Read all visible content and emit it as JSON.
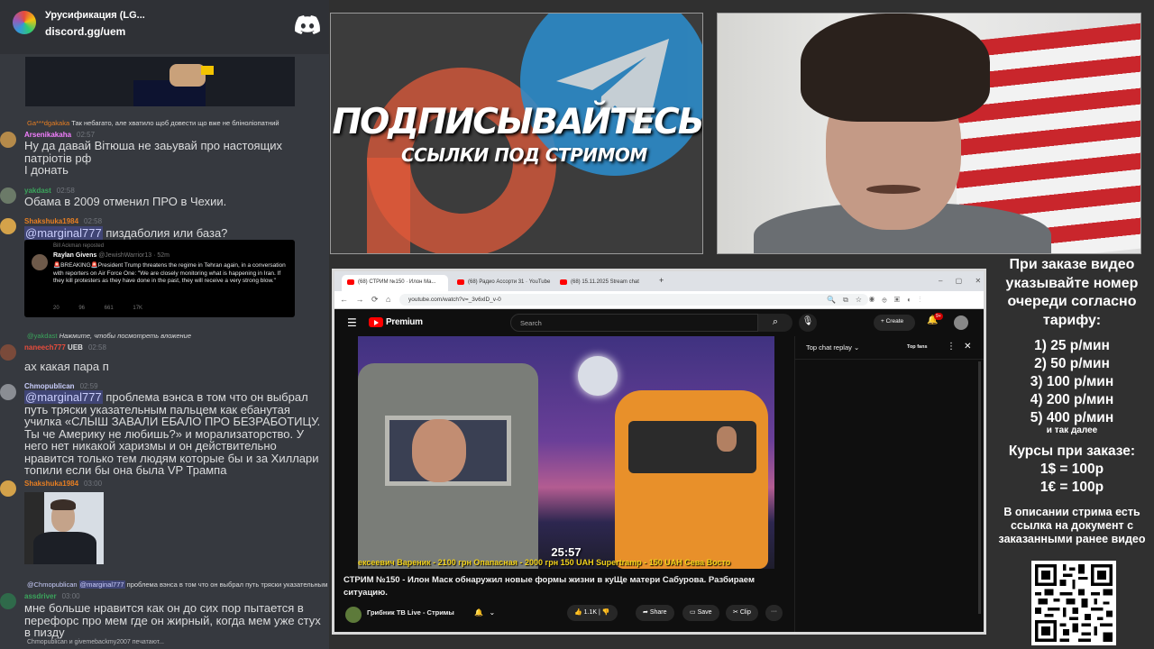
{
  "discord": {
    "server_name": "Урусификация (LG...",
    "server_link": "discord.gg/uem",
    "messages": [
      {
        "reply_name": "Ga***dgakaka",
        "reply_text": "Так небагато, але хватило щоб довести що вже не бліноліопатний",
        "user": "Arsenikakaha",
        "time": "02:57",
        "text": "Ну да давай Вітюша не заьувай про настоящих патріотів рф\nІ донать"
      },
      {
        "user": "yakdast",
        "time": "02:58",
        "text": "Обама в 2009 отменил ПРО в Чехии."
      },
      {
        "user": "Shakshuka1984",
        "time": "02:58",
        "mention": "@marginal777",
        "text": " пиздаболия или база?"
      },
      {
        "reply_name": "@yakdast",
        "reply_text": "Нажмите, чтобы посмотреть вложение",
        "user": "naneech777",
        "user_tag": "UEB",
        "time": "02:58",
        "text": "ах какая пара п"
      },
      {
        "user": "Chmopublican",
        "time": "02:59",
        "mention": "@marginal777",
        "text": " проблема вэнса в том что он выбрал путь тряски указательным пальцем как ебанутая училка «СЛЫШ ЗАВАЛИ ЕБАЛО ПРО БЕЗРАБОТИЦУ. Ты че Америку не любишь?» и морализаторство. У него нет никакой харизмы и он действительно нравится только тем людям которые бы и за Хиллари топили если бы она была VP Трампа"
      },
      {
        "user": "Shakshuka1984",
        "time": "03:00"
      },
      {
        "reply_name": "@Chmopublican",
        "reply_mention": "@marginal777",
        "reply_text": " проблема вэнса в том что он выбрал путь тряски указательным п...",
        "user": "assdriver",
        "time": "03:00",
        "text": "мне больше нравится как он до сих пор пытается в перефорс про мем где он жирный, когда мем уже стух в пизду"
      }
    ],
    "tweet": {
      "reposted": "Bill Ackman reposted",
      "name": "Raylan Givens",
      "handle": "@JewishWarrior13 · 52m",
      "body": "🚨BREAKING🚨President Trump threatens the regime in Tehran again, in a conversation with reporters on Air Force One: \"We are closely monitoring what is happening in Iran. If they kill protesters as they have done in the past, they will receive a very strong blow.\"",
      "stats": "20 96 661 17K"
    },
    "typing": "Chmopublican и givemebackmy2007 печатают..."
  },
  "promo": {
    "big_text": "ПОДПИСЫВАЙТЕСЬ",
    "small_text": "ССЫЛКИ ПОД СТРИМОМ"
  },
  "browser": {
    "tabs": [
      "(68) СТРИМ №150 · Илон Ма...",
      "(68) Радио Ассорти 31 · YouTube",
      "(68) 15.11.2025 Stream chat"
    ],
    "url": "youtube.com/watch?v=_3v6xlD_v-0",
    "yt_name": "Premium",
    "search_placeholder": "Search",
    "create_label": "Create",
    "notif_count": "9+",
    "video_time": "25:57",
    "ticker": "ексеевич Вареник - 2100 грн   Опапасная - 2000 грн 150 UAH   Supertramp - 150 UAH   Сева Восто",
    "video_title": "СТРИМ №150 - Илон Маск обнаружил новые формы жизни в куЩе матери Сабурова. Разбираем ситуацию.",
    "channel": "Грибник ТВ Live - Стримы",
    "likes": "1.1K",
    "share": "Share",
    "save": "Save",
    "clip": "Clip",
    "chat_mode": "Top chat replay",
    "top_fans": "Top fans"
  },
  "info": {
    "heading": "При заказе видео указывайте номер очереди согласно тарифу:",
    "rates": [
      "1) 25 р/мин",
      "2) 50 р/мин",
      "3) 100 р/мин",
      "4) 200 р/мин",
      "5) 400 р/мин"
    ],
    "etc": "и так далее",
    "course_heading": "Курсы при заказе:",
    "usd": "1$ = 100р",
    "eur": "1€ = 100р",
    "doc_note": "В описании стрима есть ссылка на документ с заказанными ранее видео"
  }
}
